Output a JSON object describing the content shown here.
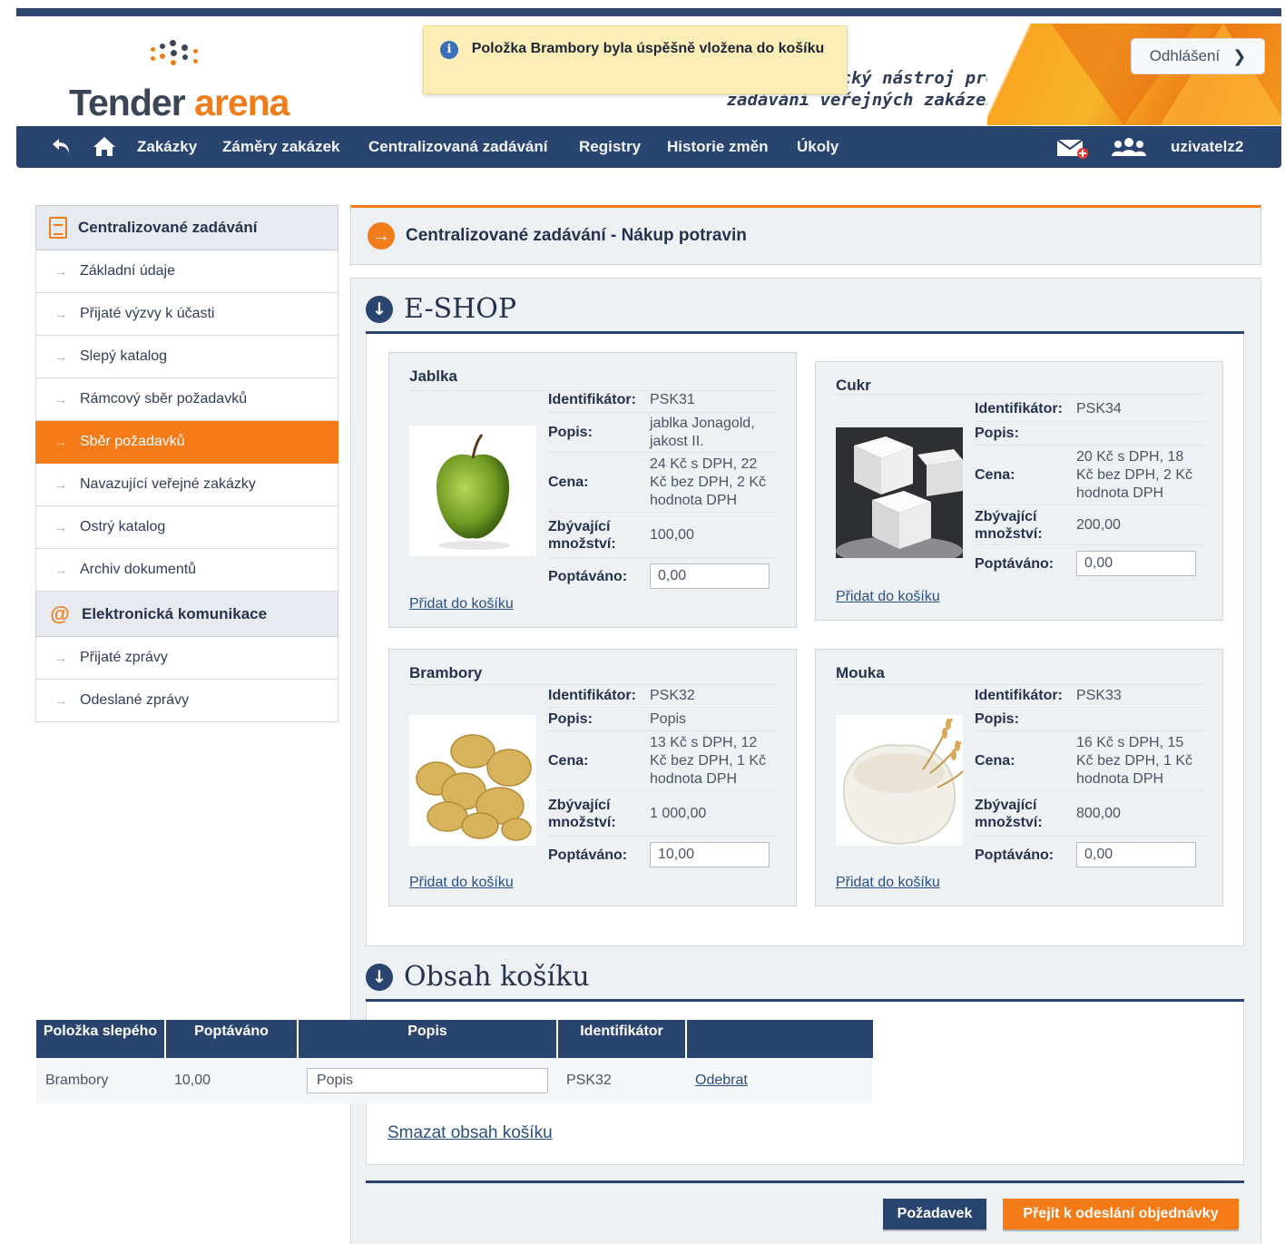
{
  "toast": {
    "message": "Položka Brambory byla úspěšně vložena do košíku",
    "icon": "info-icon"
  },
  "header": {
    "logo_word1": "Tender",
    "logo_word2": "arena",
    "tagline_line1": "ický nástroj pro",
    "tagline_line2": "zadávání veřejných zakázek",
    "logout_label": "Odhlášení",
    "colors": {
      "brand_orange": "#f07d1a",
      "brand_navy": "#2a4470"
    }
  },
  "nav": {
    "items": [
      "Zakázky",
      "Záměry zakázek",
      "Centralizovaná zadávání",
      "Registry",
      "Historie změn",
      "Úkoly"
    ],
    "username": "uzivatelz2"
  },
  "sidebar": {
    "section1_title": "Centralizované zadávání",
    "section1_items": [
      "Základní údaje",
      "Přijaté výzvy k účasti",
      "Slepý katalog",
      "Rámcový sběr požadavků",
      "Sběr požadavků",
      "Navazující veřejné zakázky",
      "Ostrý katalog",
      "Archiv dokumentů"
    ],
    "active_item": "Sběr požadavků",
    "section2_title": "Elektronická komunikace",
    "section2_items": [
      "Přijaté zprávy",
      "Odeslané zprávy"
    ]
  },
  "main": {
    "title": "Centralizované zadávání - Nákup potravin",
    "eshop_title": "E-SHOP",
    "labels": {
      "identifier": "Identifikátor:",
      "description": "Popis:",
      "price": "Cena:",
      "remaining": "Zbývající množství:",
      "requested": "Poptáváno:",
      "add_to_cart": "Přidat do košíku"
    },
    "products": [
      {
        "name": "Jablka",
        "identifier": "PSK31",
        "description": "jablka Jonagold, jakost II.",
        "price": "24 Kč s DPH, 22 Kč bez DPH, 2 Kč hodnota DPH",
        "remaining": "100,00",
        "requested": "0,00",
        "image": "apple-image"
      },
      {
        "name": "Cukr",
        "identifier": "PSK34",
        "description": "",
        "price": "20 Kč s DPH, 18 Kč bez DPH, 2 Kč hodnota DPH",
        "remaining": "200,00",
        "requested": "0,00",
        "image": "sugar-cubes-image"
      },
      {
        "name": "Brambory",
        "identifier": "PSK32",
        "description": "Popis",
        "price": "13 Kč s DPH, 12 Kč bez DPH, 1 Kč hodnota DPH",
        "remaining": "1 000,00",
        "requested": "10,00",
        "image": "potatoes-image"
      },
      {
        "name": "Mouka",
        "identifier": "PSK33",
        "description": "",
        "price": "16 Kč s DPH, 15 Kč bez DPH, 1 Kč hodnota DPH",
        "remaining": "800,00",
        "requested": "0,00",
        "image": "flour-image"
      }
    ],
    "cart": {
      "title": "Obsah košíku",
      "columns": [
        "Položka slepého",
        "Poptáváno",
        "Popis",
        "Identifikátor",
        ""
      ],
      "rows": [
        {
          "item": "Brambory",
          "requested": "10,00",
          "description": "Popis",
          "identifier": "PSK32",
          "action": "Odebrat"
        }
      ],
      "clear_label": "Smazat obsah košíku"
    },
    "buttons": {
      "request": "Požadavek",
      "checkout": "Přejít k odeslání objednávky"
    }
  }
}
